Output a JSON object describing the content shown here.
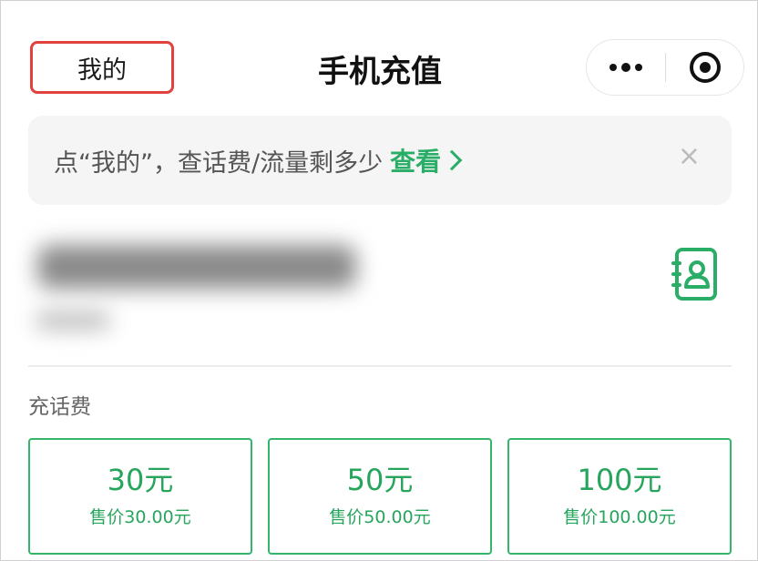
{
  "nav": {
    "mine_label": "我的",
    "title": "手机充值"
  },
  "tip": {
    "text": "点“我的”，查话费/流量剩多少",
    "link_label": "查看",
    "close_label": "×"
  },
  "recharge": {
    "section_title": "充话费",
    "options": [
      {
        "amount": "30元",
        "price": "售价30.00元"
      },
      {
        "amount": "50元",
        "price": "售价50.00元"
      },
      {
        "amount": "100元",
        "price": "售价100.00元"
      }
    ]
  },
  "colors": {
    "accent_green": "#2aae67",
    "highlight_red": "#e0423e"
  }
}
